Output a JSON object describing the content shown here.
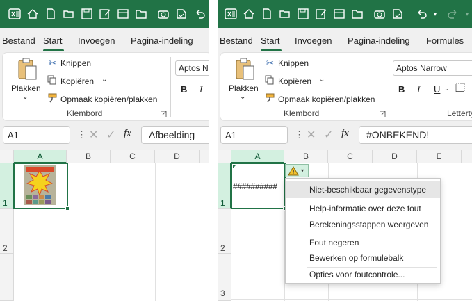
{
  "left": {
    "tabs": [
      "Bestand",
      "Start",
      "Invoegen",
      "Pagina-indeling"
    ],
    "clipboard": {
      "paste_label": "Plakken",
      "cut_label": "Knippen",
      "copy_label": "Kopiëren",
      "format_painter_label": "Opmaak kopiëren/plakken",
      "group_label": "Klembord"
    },
    "font_name": "Aptos Na",
    "name_box": "A1",
    "formula": "Afbeelding",
    "columns": [
      "A",
      "B",
      "C",
      "D"
    ],
    "rows": [
      "1",
      "2"
    ]
  },
  "right": {
    "tabs": [
      "Bestand",
      "Start",
      "Invoegen",
      "Pagina-indeling",
      "Formules"
    ],
    "clipboard": {
      "paste_label": "Plakken",
      "cut_label": "Knippen",
      "copy_label": "Kopiëren",
      "format_painter_label": "Opmaak kopiëren/plakken",
      "group_label": "Klembord"
    },
    "font_name": "Aptos Narrow",
    "font_group_label": "Letterty",
    "name_box": "A1",
    "formula": "#ONBEKEND!",
    "columns": [
      "A",
      "B",
      "C",
      "D",
      "E"
    ],
    "rows": [
      "1",
      "2",
      "3"
    ],
    "cell_a1": "##########",
    "context_menu": [
      "Niet-beschikbaar gegevenstype",
      "Help-informatie over deze fout",
      "Berekeningsstappen weergeven",
      "Fout negeren",
      "Bewerken op formulebalk",
      "Opties voor foutcontrole..."
    ]
  },
  "colors": {
    "brand_green": "#217346",
    "selection_fill": "#d3f0e0",
    "warning_yellow": "#f2c12e"
  }
}
